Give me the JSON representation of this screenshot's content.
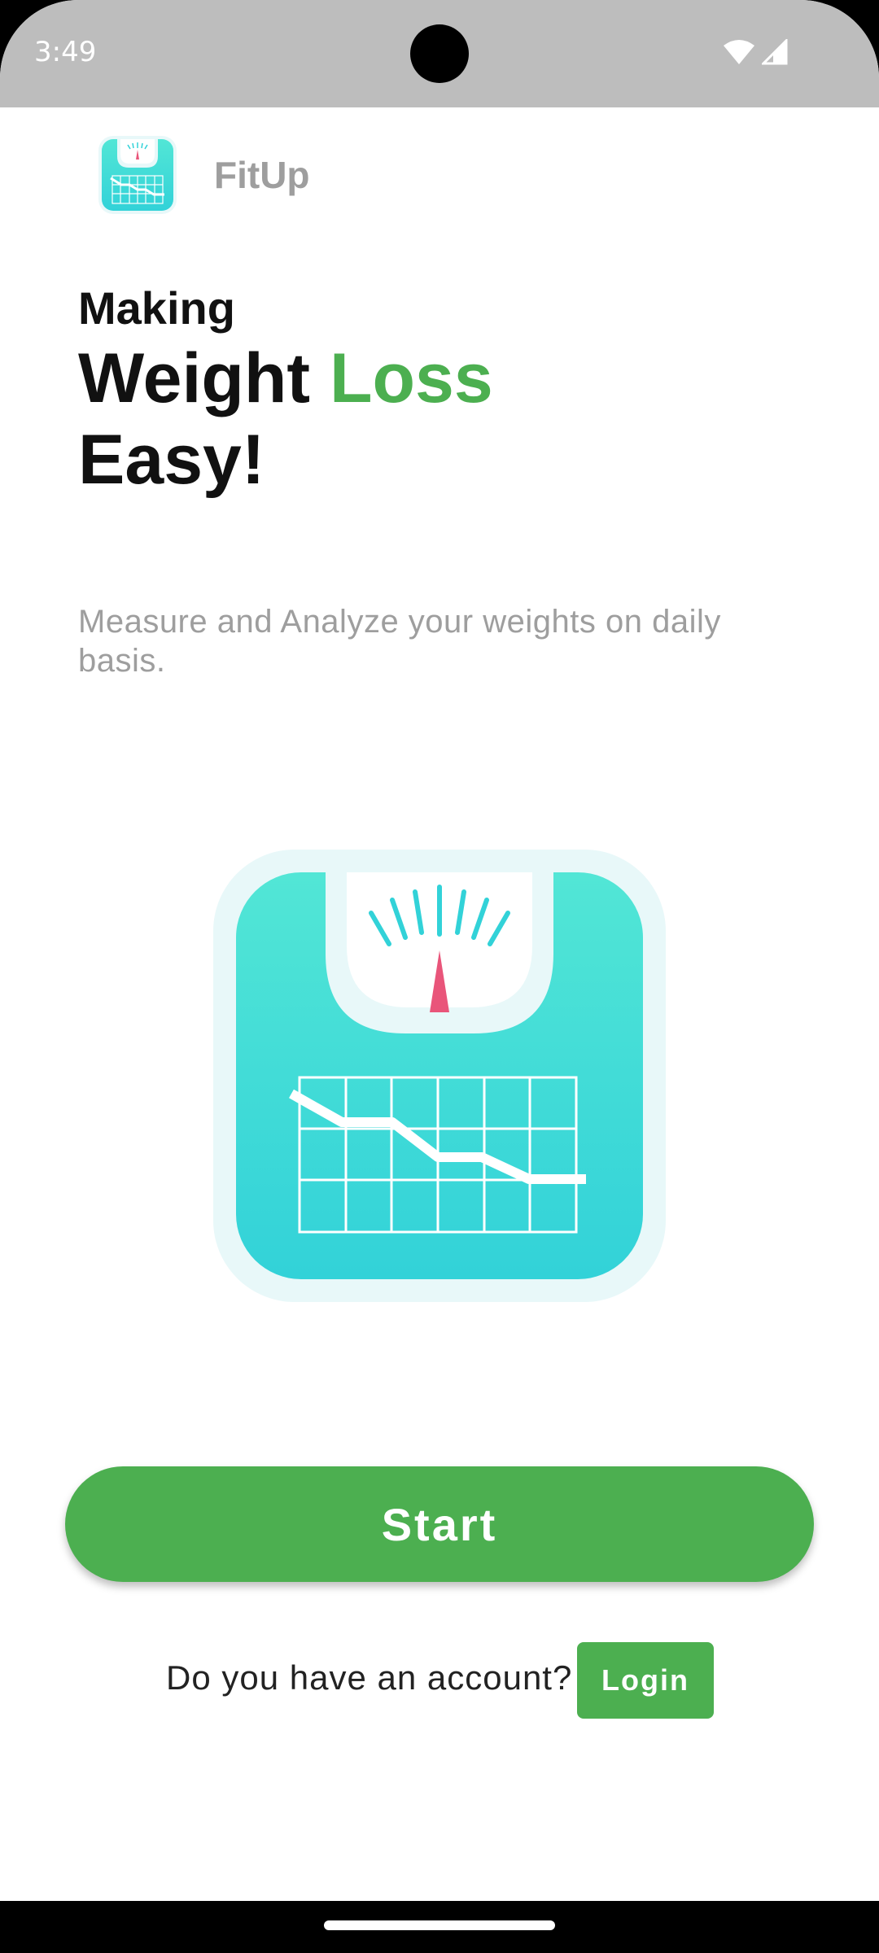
{
  "status_bar": {
    "time": "3:49"
  },
  "app": {
    "name": "FitUp"
  },
  "hero": {
    "line1": "Making",
    "line2_prefix": "Weight ",
    "line2_accent": "Loss",
    "line3": "Easy!",
    "subtitle": "Measure and Analyze your weights on daily basis."
  },
  "actions": {
    "start_label": "Start",
    "account_prompt": "Do you have an account?",
    "login_label": "Login"
  },
  "colors": {
    "accent": "#4caf50",
    "status_bar": "#bdbdbd",
    "scale_teal": "#3ad9d6",
    "needle": "#e9557a"
  },
  "icons": [
    "wifi-icon",
    "cellular-signal-icon",
    "scale-chart-icon"
  ]
}
